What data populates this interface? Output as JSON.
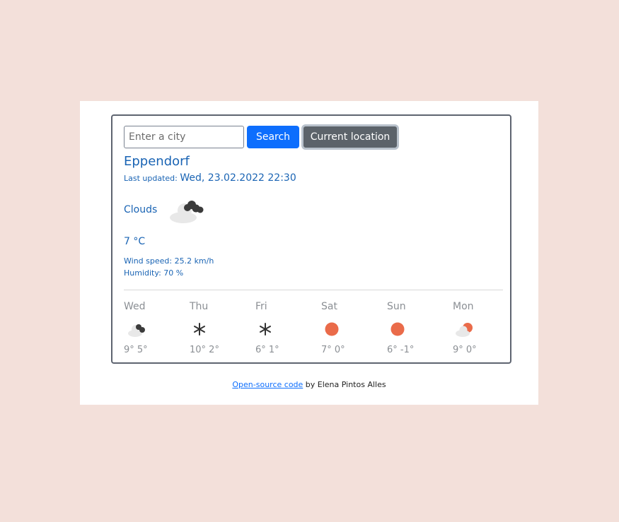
{
  "search": {
    "placeholder": "Enter a city",
    "value": "",
    "search_label": "Search",
    "location_label": "Current location"
  },
  "current": {
    "city": "Eppendorf",
    "updated_label": "Last updated:",
    "updated_value": "Wed, 23.02.2022 22:30",
    "description": "Clouds",
    "icon": "cloud-icon",
    "temperature": "7 °C",
    "wind": "Wind speed: 25.2 km/h",
    "humidity": "Humidity: 70 %"
  },
  "forecast": [
    {
      "day": "Wed",
      "icon": "cloud-icon",
      "temps": "9° 5°"
    },
    {
      "day": "Thu",
      "icon": "snowflake-icon",
      "temps": "10° 2°"
    },
    {
      "day": "Fri",
      "icon": "snowflake-icon",
      "temps": "6° 1°"
    },
    {
      "day": "Sat",
      "icon": "sun-icon",
      "temps": "7° 0°"
    },
    {
      "day": "Sun",
      "icon": "sun-icon",
      "temps": "6° -1°"
    },
    {
      "day": "Mon",
      "icon": "partly-cloudy-icon",
      "temps": "9° 0°"
    }
  ],
  "footer": {
    "link_text": "Open-source code",
    "suffix": " by Elena Pintos Alles"
  },
  "colors": {
    "background": "#f3e0da",
    "accent": "#1a64b4",
    "button_primary": "#0d6efd",
    "button_secondary": "#5c636a",
    "sun": "#ea6b4a"
  }
}
